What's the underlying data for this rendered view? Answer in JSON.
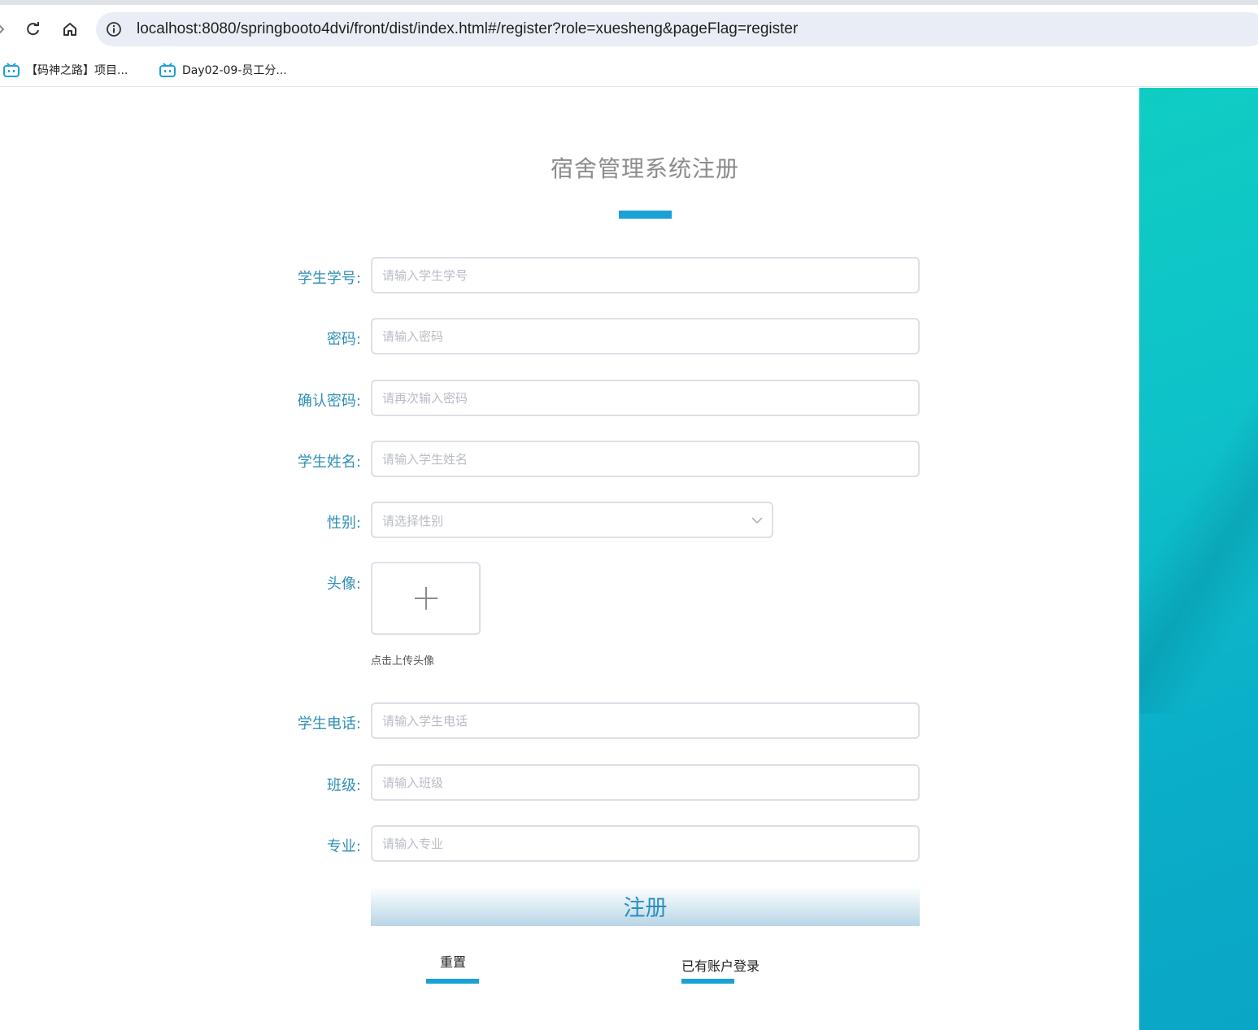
{
  "browser": {
    "url": "localhost:8080/springbooto4dvi/front/dist/index.html#/register?role=xuesheng&pageFlag=register",
    "bookmarks": [
      {
        "label": "【码神之路】项目..."
      },
      {
        "label": "Day02-09-员工分..."
      }
    ]
  },
  "page": {
    "title": "宿舍管理系统注册",
    "fields": [
      {
        "label": "学生学号:",
        "placeholder": "请输入学生学号"
      },
      {
        "label": "密码:",
        "placeholder": "请输入密码"
      },
      {
        "label": "确认密码:",
        "placeholder": "请再次输入密码"
      },
      {
        "label": "学生姓名:",
        "placeholder": "请输入学生姓名"
      }
    ],
    "gender": {
      "label": "性别:",
      "placeholder": "请选择性别"
    },
    "avatar": {
      "label": "头像:",
      "hint": "点击上传头像"
    },
    "fields2": [
      {
        "label": "学生电话:",
        "placeholder": "请输入学生电话"
      },
      {
        "label": "班级:",
        "placeholder": "请输入班级"
      },
      {
        "label": "专业:",
        "placeholder": "请输入专业"
      }
    ],
    "register_button": "注册",
    "reset_link": "重置",
    "login_link": "已有账户登录"
  },
  "colors": {
    "accent": "#1aa1d8",
    "label": "#2f8fb6",
    "side_panel": "#0ec2c9"
  }
}
